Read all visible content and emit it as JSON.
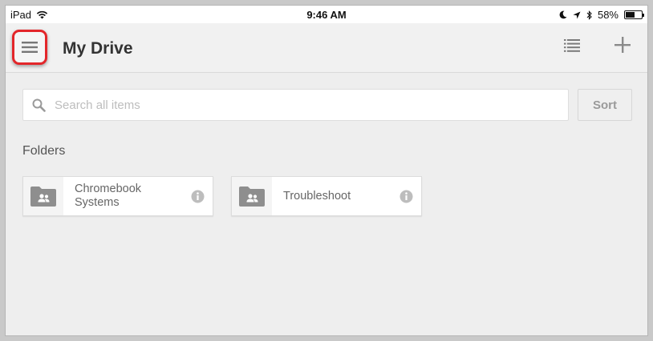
{
  "status_bar": {
    "device": "iPad",
    "time": "9:46 AM",
    "battery": "58%",
    "battery_level": 0.58
  },
  "toolbar": {
    "title": "My Drive",
    "menu_icon": "hamburger-menu-icon",
    "list_view_icon": "list-view-icon",
    "add_icon": "plus-icon",
    "highlight_color": "#e3262a"
  },
  "search": {
    "placeholder": "Search all items",
    "value": "",
    "sort_label": "Sort"
  },
  "folders_section": {
    "heading": "Folders",
    "items": [
      {
        "name": "Chromebook Systems",
        "icon": "shared-folder-icon"
      },
      {
        "name": "Troubleshoot",
        "icon": "shared-folder-icon"
      }
    ]
  }
}
